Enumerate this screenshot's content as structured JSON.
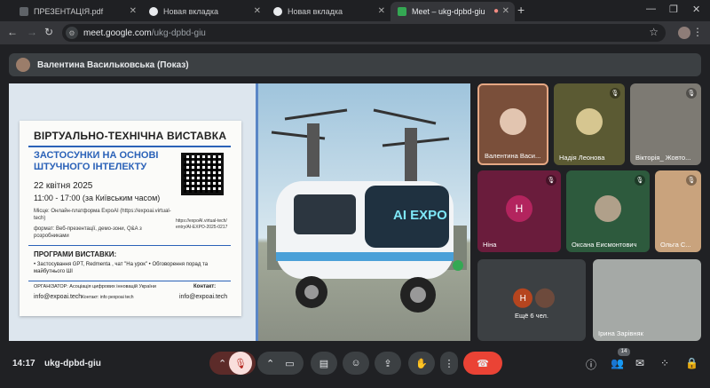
{
  "browser": {
    "tabs": [
      {
        "title": "ПРЕЗЕНТАЦІЯ.pdf",
        "favicon_color": "#5f6368"
      },
      {
        "title": "Новая вкладка",
        "favicon_color": "#e8eaed"
      },
      {
        "title": "Новая вкладка",
        "favicon_color": "#e8eaed"
      },
      {
        "title": "Meet – ukg-dpbd-giu",
        "favicon_color": "#34a853"
      }
    ],
    "url_host": "meet.google.com",
    "url_path": "/ukg-dpbd-giu"
  },
  "presenter": {
    "name": "Валентина Васильковська (Показ)"
  },
  "slide": {
    "title": "ВІРТУАЛЬНО-ТЕХНІЧНА ВИСТАВКА",
    "headline": "ЗАСТОСУНКИ НА ОСНОВІ ШТУЧНОГО ІНТЕЛЕКТУ",
    "date": "22 квітня 2025",
    "time": "11:00 - 17:00 (за Київським часом)",
    "place": "Місце: Онлайн-платформа ExpoAI (https://expoai.virtual-tech)",
    "format": "формат: Веб-презентації, демо-зони, Q&A з розробниками",
    "qr_link": "https://expoAI.virtual-tech/ entry/AI-EXPO-2025-0217",
    "program_title": "ПРОГРАМИ ВИСТАВКИ:",
    "program_items": "• Застосування GPT, Redmenta , чат \"На урок\" • Обговорення порад та майбутнього ШІ",
    "organizer": "ОРГАНІЗАТОР: Асоціація цифрових інновацій України",
    "email_left": "info@expoai.tech",
    "contact_small": "Контакт: info pexpoai tech",
    "contact_label": "Контакт:",
    "email_right": "info@expoai.tech",
    "image_text": "AI EXPO"
  },
  "participants": [
    {
      "name": "Валентина Васи...",
      "initial": "",
      "bg": "#7a4f3a",
      "muted": false
    },
    {
      "name": "Надія Леонова",
      "initial": "",
      "bg": "#5b5a33",
      "muted": true
    },
    {
      "name": "Вікторія_ Жовто...",
      "initial": "",
      "bg": "#7d7a73",
      "muted": true
    },
    {
      "name": "Ніна",
      "initial": "Н",
      "bg": "#6a1c3c",
      "muted": true
    },
    {
      "name": "Оксана Еисмонтович",
      "initial": "",
      "bg": "#2d5a3d",
      "muted": true
    },
    {
      "name": "Ольга С...",
      "initial": "",
      "bg": "#c9a37d",
      "muted": true
    },
    {
      "name": "Ещё 6 чел.",
      "initial": "Н",
      "bg": "#3c4043",
      "muted": false
    },
    {
      "name": "Ірина Зарівняк",
      "initial": "",
      "bg": "#a5a9a6",
      "muted": false
    }
  ],
  "meeting": {
    "clock": "14:17",
    "code": "ukg-dpbd-giu",
    "participant_count": "14"
  }
}
